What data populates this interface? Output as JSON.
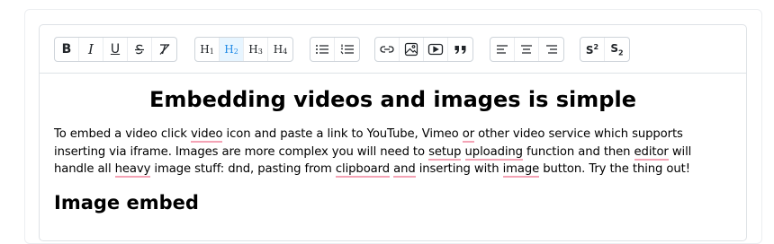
{
  "toolbar": {
    "formatting": [
      {
        "name": "bold-button",
        "label": "B",
        "icon": "bold-icon"
      },
      {
        "name": "italic-button",
        "label": "I",
        "icon": "italic-icon"
      },
      {
        "name": "underline-button",
        "label": "U",
        "icon": "underline-icon"
      },
      {
        "name": "strikethrough-button",
        "label": "S",
        "icon": "strikethrough-icon"
      },
      {
        "name": "clear-formatting-button",
        "label": "T",
        "icon": "clear-formatting-icon"
      }
    ],
    "headings": [
      {
        "name": "heading-1-button",
        "label": "H",
        "level": "1",
        "active": false
      },
      {
        "name": "heading-2-button",
        "label": "H",
        "level": "2",
        "active": true
      },
      {
        "name": "heading-3-button",
        "label": "H",
        "level": "3",
        "active": false
      },
      {
        "name": "heading-4-button",
        "label": "H",
        "level": "4",
        "active": false
      }
    ],
    "lists": [
      {
        "name": "bullet-list-button",
        "icon": "bullet-list-icon"
      },
      {
        "name": "ordered-list-button",
        "icon": "ordered-list-icon"
      }
    ],
    "insert": [
      {
        "name": "link-button",
        "icon": "link-icon"
      },
      {
        "name": "image-button",
        "icon": "image-icon"
      },
      {
        "name": "video-button",
        "icon": "video-icon"
      },
      {
        "name": "blockquote-button",
        "icon": "quote-icon"
      }
    ],
    "align": [
      {
        "name": "align-left-button",
        "icon": "align-left-icon"
      },
      {
        "name": "align-center-button",
        "icon": "align-center-icon"
      },
      {
        "name": "align-right-button",
        "icon": "align-right-icon"
      }
    ],
    "script": [
      {
        "name": "superscript-button",
        "label": "S",
        "mark": "2",
        "icon": "superscript-icon"
      },
      {
        "name": "subscript-button",
        "label": "S",
        "mark": "2",
        "icon": "subscript-icon"
      }
    ],
    "active_color": "#228be6"
  },
  "content": {
    "title": "Embedding videos and images is simple",
    "paragraph": [
      {
        "text": "To embed a video click ",
        "flag": false
      },
      {
        "text": "video",
        "flag": true
      },
      {
        "text": " icon and paste a link to YouTube, Vimeo ",
        "flag": false
      },
      {
        "text": "or",
        "flag": true
      },
      {
        "text": " other video service which supports inserting via iframe. Images are more complex you will need to ",
        "flag": false
      },
      {
        "text": "setup",
        "flag": true
      },
      {
        "text": " ",
        "flag": false
      },
      {
        "text": "uploading",
        "flag": true
      },
      {
        "text": " function and then ",
        "flag": false
      },
      {
        "text": "editor",
        "flag": true
      },
      {
        "text": " will handle all ",
        "flag": false
      },
      {
        "text": "heavy",
        "flag": true
      },
      {
        "text": " image stuff: dnd, pasting from ",
        "flag": false
      },
      {
        "text": "clipboard",
        "flag": true
      },
      {
        "text": " ",
        "flag": false
      },
      {
        "text": "and",
        "flag": true
      },
      {
        "text": " inserting with ",
        "flag": false
      },
      {
        "text": "image",
        "flag": true
      },
      {
        "text": " button. Try the thing out!",
        "flag": false
      }
    ],
    "subheading": "Image embed",
    "spellcheck_color": "#f4a3b5"
  }
}
